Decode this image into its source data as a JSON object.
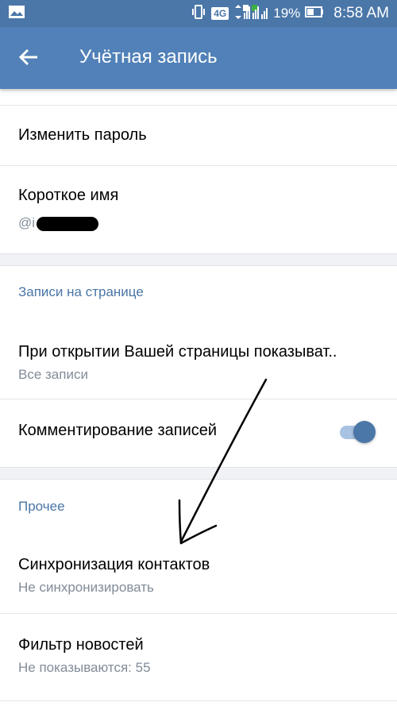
{
  "status_bar": {
    "network": "4G",
    "battery": "19%",
    "time": "8:58 AM",
    "icons": [
      "image-icon",
      "vibrate-icon",
      "signal-icon",
      "battery-icon"
    ]
  },
  "app_bar": {
    "title": "Учётная запись",
    "back_icon": "arrow-left-icon"
  },
  "account": {
    "change_password": "Изменить пароль",
    "short_name_label": "Короткое имя",
    "short_name_value": "@i"
  },
  "wall": {
    "header": "Записи на странице",
    "show_on_open_label": "При открытии Вашей страницы показыват..",
    "show_on_open_value": "Все записи",
    "comments_label": "Комментирование записей",
    "comments_enabled": true
  },
  "other": {
    "header": "Прочее",
    "sync_contacts_label": "Синхронизация контактов",
    "sync_contacts_value": "Не синхронизировать",
    "news_filter_label": "Фильтр новостей",
    "news_filter_value": "Не показываются: 55"
  },
  "colors": {
    "accent": "#5181b8",
    "section_header": "#4a76a8",
    "secondary_text": "#818c99"
  }
}
